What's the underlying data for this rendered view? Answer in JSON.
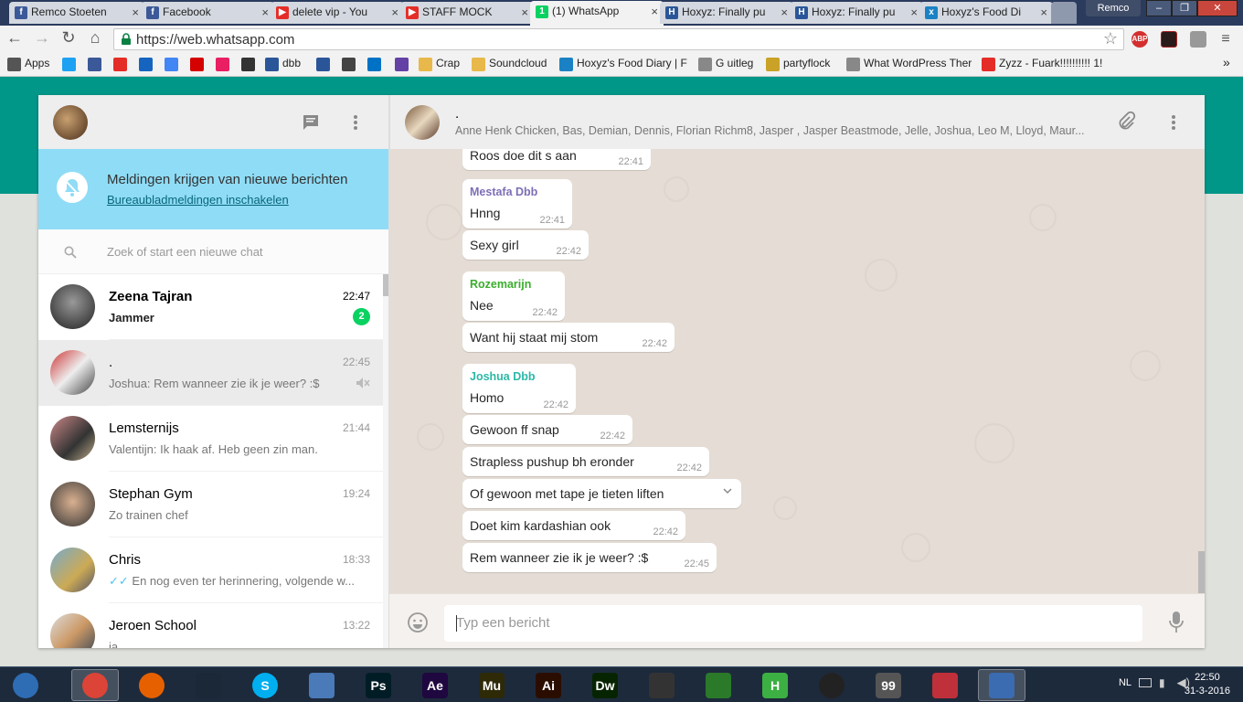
{
  "browser": {
    "tabs": [
      {
        "title": "Remco Stoeten",
        "fav_color": "#3b5998",
        "fav": "f"
      },
      {
        "title": "Facebook",
        "fav_color": "#3b5998",
        "fav": "f"
      },
      {
        "title": "delete vip - You",
        "fav_color": "#e52d27",
        "fav": "▶"
      },
      {
        "title": "STAFF MOCK",
        "fav_color": "#e52d27",
        "fav": "▶"
      },
      {
        "title": "(1) WhatsApp",
        "fav_color": "#09d261",
        "fav": "1"
      },
      {
        "title": "Hoxyz: Finally pu",
        "fav_color": "#2a5699",
        "fav": "H"
      },
      {
        "title": "Hoxyz: Finally pu",
        "fav_color": "#2a5699",
        "fav": "H"
      },
      {
        "title": "Hoxyz's Food Di",
        "fav_color": "#1a82c4",
        "fav": "x"
      }
    ],
    "profile": "Remco",
    "url": "https://web.whatsapp.com",
    "bookmarks": [
      {
        "label": "Apps",
        "color": "#555"
      },
      {
        "label": "",
        "color": "#1da1f2"
      },
      {
        "label": "",
        "color": "#3b5998"
      },
      {
        "label": "",
        "color": "#e52d27"
      },
      {
        "label": "",
        "color": "#1565c0"
      },
      {
        "label": "",
        "color": "#4285f4"
      },
      {
        "label": "",
        "color": "#d50000"
      },
      {
        "label": "",
        "color": "#e91e63"
      },
      {
        "label": "",
        "color": "#333"
      },
      {
        "label": "dbb",
        "color": "#2a5699"
      },
      {
        "label": "",
        "color": "#2a5699"
      },
      {
        "label": "",
        "color": "#444"
      },
      {
        "label": "",
        "color": "#0072c6"
      },
      {
        "label": "",
        "color": "#6441a5"
      },
      {
        "label": "Crap",
        "color": "#e8b84a"
      },
      {
        "label": "Soundcloud",
        "color": "#e8b84a"
      },
      {
        "label": "Hoxyz's Food Diary | F",
        "color": "#1a82c4"
      },
      {
        "label": "G uitleg",
        "color": "#888"
      },
      {
        "label": "partyflock",
        "color": "#c9a227"
      },
      {
        "label": "What WordPress Ther",
        "color": "#888"
      },
      {
        "label": "Zyzz - Fuark!!!!!!!!!! 1!",
        "color": "#e52d27"
      }
    ]
  },
  "notification": {
    "title": "Meldingen krijgen van nieuwe berichten",
    "link": "Bureaubladmeldingen inschakelen"
  },
  "search": {
    "placeholder": "Zoek of start een nieuwe chat"
  },
  "chats": [
    {
      "name": "Zeena Tajran",
      "time": "22:47",
      "preview": "Jammer",
      "unread": "2",
      "bold": true,
      "selected": false,
      "muted": false,
      "checks": false
    },
    {
      "name": ".",
      "time": "22:45",
      "preview": "Joshua: Rem wanneer zie ik je weer? :$",
      "unread": "",
      "bold": false,
      "selected": true,
      "muted": true,
      "checks": false
    },
    {
      "name": "Lemsternijs",
      "time": "21:44",
      "preview": "Valentijn: Ik haak af. Heb geen zin man.",
      "unread": "",
      "bold": false,
      "selected": false,
      "muted": false,
      "checks": false
    },
    {
      "name": "Stephan Gym",
      "time": "19:24",
      "preview": "Zo trainen chef",
      "unread": "",
      "bold": false,
      "selected": false,
      "muted": false,
      "checks": false
    },
    {
      "name": "Chris",
      "time": "18:33",
      "preview": "En nog even ter herinnering, volgende w...",
      "unread": "",
      "bold": false,
      "selected": false,
      "muted": false,
      "checks": true
    },
    {
      "name": "Jeroen School",
      "time": "13:22",
      "preview": "ja",
      "unread": "",
      "bold": false,
      "selected": false,
      "muted": false,
      "checks": false
    }
  ],
  "conversation": {
    "name": ".",
    "members": "Anne Henk Chicken, Bas, Demian, Dennis, Florian Richm8, Jasper , Jasper Beastmode, Jelle, Joshua, Leo M, Lloyd, Maur..."
  },
  "messages": [
    {
      "sender": "",
      "sender_color": "",
      "text": "Roos doe dit s aan",
      "time": "22:41",
      "menu": false
    },
    {
      "sender": "Mestafa Dbb",
      "sender_color": "#7e6fb6",
      "text": "Hnng",
      "time": "22:41",
      "menu": false
    },
    {
      "sender": "",
      "sender_color": "",
      "text": "Sexy girl",
      "time": "22:42",
      "menu": false
    },
    {
      "sender": "Rozemarijn",
      "sender_color": "#3bad2d",
      "text": "Nee",
      "time": "22:42",
      "menu": false
    },
    {
      "sender": "",
      "sender_color": "",
      "text": "Want hij staat mij stom",
      "time": "22:42",
      "menu": false
    },
    {
      "sender": "Joshua Dbb",
      "sender_color": "#2bb9a7",
      "text": "Homo",
      "time": "22:42",
      "menu": false
    },
    {
      "sender": "",
      "sender_color": "",
      "text": "Gewoon ff snap",
      "time": "22:42",
      "menu": false
    },
    {
      "sender": "",
      "sender_color": "",
      "text": "Strapless pushup bh eronder",
      "time": "22:42",
      "menu": false
    },
    {
      "sender": "",
      "sender_color": "",
      "text": "Of gewoon met tape je tieten liften",
      "time": "",
      "menu": true
    },
    {
      "sender": "",
      "sender_color": "",
      "text": "Doet kim kardashian ook",
      "time": "22:42",
      "menu": false
    },
    {
      "sender": "",
      "sender_color": "",
      "text": "Rem wanneer zie ik je weer? :$",
      "time": "22:45",
      "menu": false
    }
  ],
  "composer": {
    "placeholder": "Typ een bericht"
  },
  "taskbar": {
    "apps": [
      {
        "name": "start",
        "label": "",
        "color": "#2e6db4"
      },
      {
        "name": "chrome",
        "label": "",
        "color": "#db4437"
      },
      {
        "name": "firefox",
        "label": "",
        "color": "#e66000"
      },
      {
        "name": "steam",
        "label": "",
        "color": "#1b2838"
      },
      {
        "name": "skype",
        "label": "S",
        "color": "#00aff0"
      },
      {
        "name": "keyboard",
        "label": "",
        "color": "#4a7ab8"
      },
      {
        "name": "photoshop",
        "label": "Ps",
        "color": "#001d26"
      },
      {
        "name": "after-effects",
        "label": "Ae",
        "color": "#1f0740"
      },
      {
        "name": "muse",
        "label": "Mu",
        "color": "#2e2a08"
      },
      {
        "name": "illustrator",
        "label": "Ai",
        "color": "#2b0d00"
      },
      {
        "name": "dreamweaver",
        "label": "Dw",
        "color": "#072401"
      },
      {
        "name": "video",
        "label": "",
        "color": "#333"
      },
      {
        "name": "app-green",
        "label": "",
        "color": "#2a7a2a"
      },
      {
        "name": "app-h",
        "label": "H",
        "color": "#3cb043"
      },
      {
        "name": "app-circle",
        "label": "",
        "color": "#222"
      },
      {
        "name": "app-99",
        "label": "99",
        "color": "#555"
      },
      {
        "name": "app-red",
        "label": "",
        "color": "#c0303a"
      },
      {
        "name": "app-blue",
        "label": "",
        "color": "#3b6bb0"
      }
    ],
    "lang": "NL",
    "time": "22:50",
    "date": "31-3-2016"
  }
}
